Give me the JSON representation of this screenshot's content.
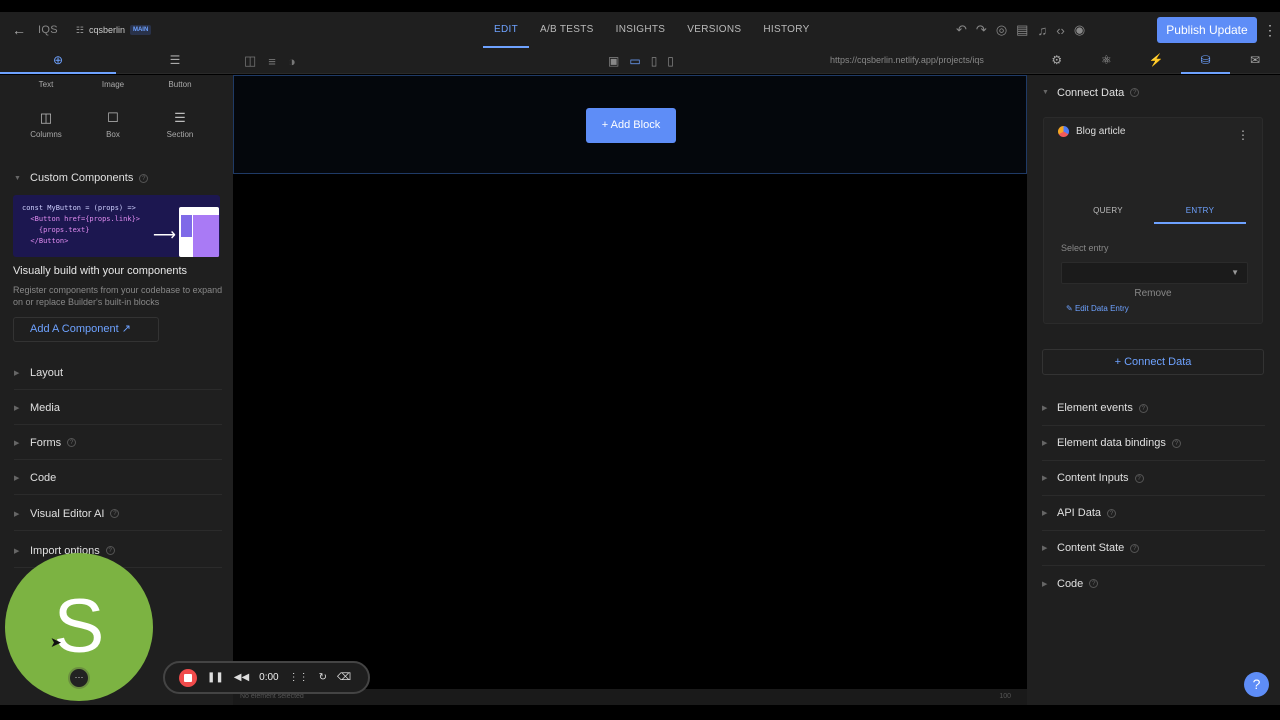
{
  "topbar": {
    "back_icon": "arrow-left-icon",
    "org": "IQS",
    "site_name": "cqsberlin",
    "branch_badge": "MAIN",
    "tabs": [
      "EDIT",
      "A/B TESTS",
      "INSIGHTS",
      "VERSIONS",
      "HISTORY"
    ],
    "active_tab": "EDIT",
    "publish_label": "Publish Update",
    "accent": "#5e8df7"
  },
  "left_panel": {
    "tabs": [
      "add-icon",
      "layers-icon"
    ],
    "top_labels": [
      "Text",
      "Image",
      "Button"
    ],
    "blocks": [
      {
        "label": "Columns",
        "icon": "columns-icon"
      },
      {
        "label": "Box",
        "icon": "box-icon"
      },
      {
        "label": "Section",
        "icon": "section-icon"
      }
    ],
    "custom_components": {
      "title": "Custom Components",
      "code_lines": [
        "const MyButton = (props) =>",
        "  <Button href={props.link}>",
        "    {props.text}",
        "  </Button>"
      ],
      "heading": "Visually build with your components",
      "description": "Register components from your codebase to expand on or replace Builder's built-in blocks",
      "add_label": "Add A Component"
    },
    "sections": [
      "Layout",
      "Media",
      "Forms",
      "Code",
      "Visual Editor AI",
      "Import options"
    ]
  },
  "canvas": {
    "url": "https://cqsberlin.netlify.app/projects/iqs",
    "add_block_label": "+ Add Block",
    "status": "No element selected",
    "zoom": "100"
  },
  "right_panel": {
    "connect_data": {
      "title": "Connect Data",
      "model": "Blog article",
      "tabs": [
        "QUERY",
        "ENTRY"
      ],
      "active_tab": "ENTRY",
      "select_label": "Select entry",
      "edit_label": "Edit Data Entry",
      "remove_label": "Remove",
      "connect_button": "+ Connect Data"
    },
    "sections": [
      "Element events",
      "Element data bindings",
      "Content Inputs",
      "API Data",
      "Content State",
      "Code"
    ]
  },
  "recorder": {
    "avatar_letter": "S",
    "time": "0:00"
  }
}
